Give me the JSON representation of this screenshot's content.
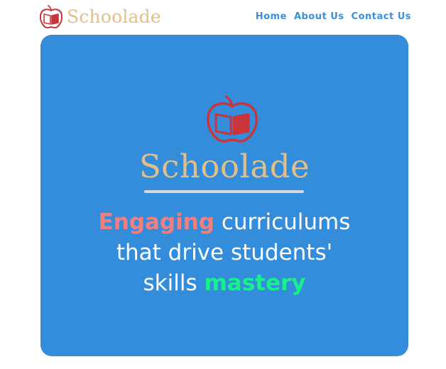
{
  "header": {
    "brand_name": "Schoolade",
    "nav": [
      {
        "label": "Home"
      },
      {
        "label": "About Us"
      },
      {
        "label": "Contact Us"
      }
    ]
  },
  "hero": {
    "brand_name": "Schoolade",
    "tagline": {
      "highlight_1": "Engaging",
      "line_1_rest": "curriculums",
      "line_2": "that drive students'",
      "line_3_start": "skills",
      "highlight_2": "mastery"
    }
  },
  "icons": {
    "logo": "apple-book-icon"
  },
  "colors": {
    "brand_gold": "#E2BE88",
    "nav_blue": "#3A8FDB",
    "hero_blue": "#348DDB",
    "logo_red": "#C9353B",
    "highlight_pink": "#F08080",
    "highlight_green": "#17F08C",
    "divider_gray": "#D9D9D9"
  }
}
